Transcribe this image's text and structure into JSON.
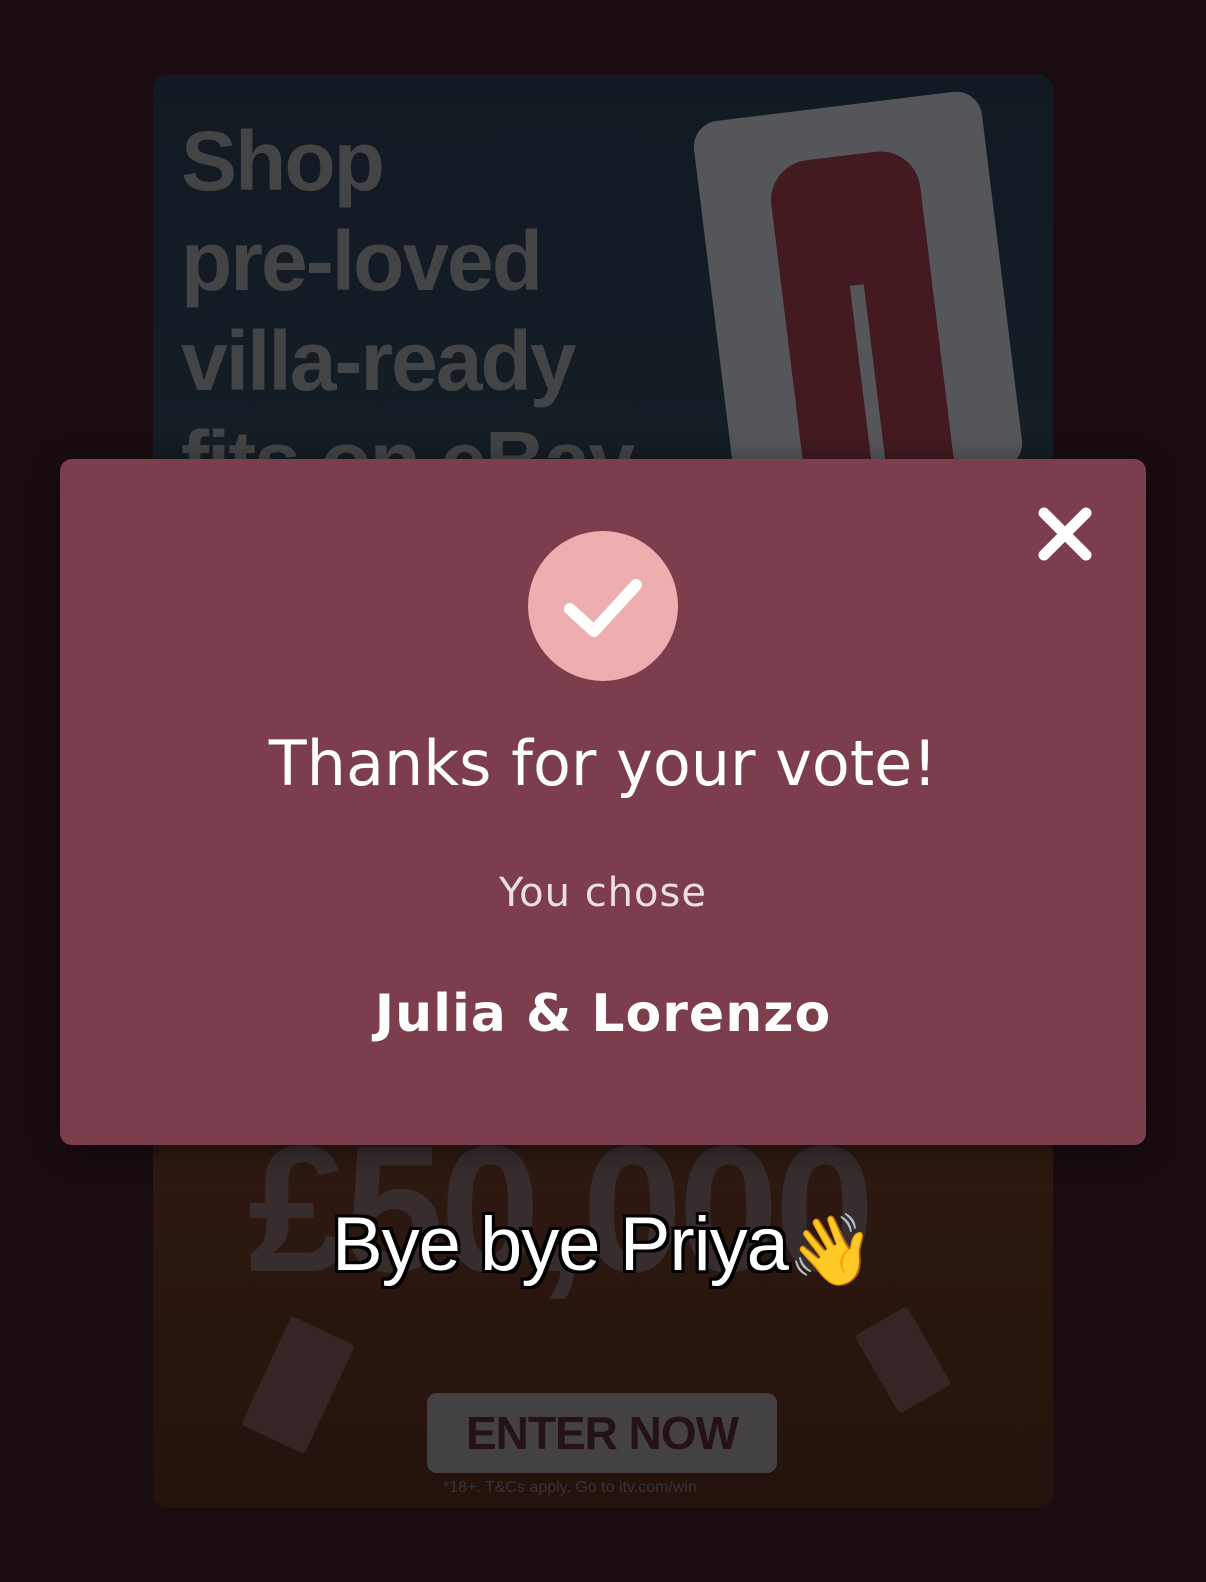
{
  "ad": {
    "headline": "Shop\npre-loved\nvilla-ready\nfits on eBay",
    "prize_amount": "£50,000",
    "cta_label": "ENTER NOW",
    "terms": "*18+. T&Cs apply. Go to itv.com/win"
  },
  "modal": {
    "title": "Thanks for your vote!",
    "subtitle": "You chose",
    "choice": "Julia & Lorenzo",
    "accent_color": "#eeadae",
    "background_color": "#7c3d4d"
  },
  "caption": {
    "text": "Bye bye Priya",
    "emoji": "👋"
  }
}
